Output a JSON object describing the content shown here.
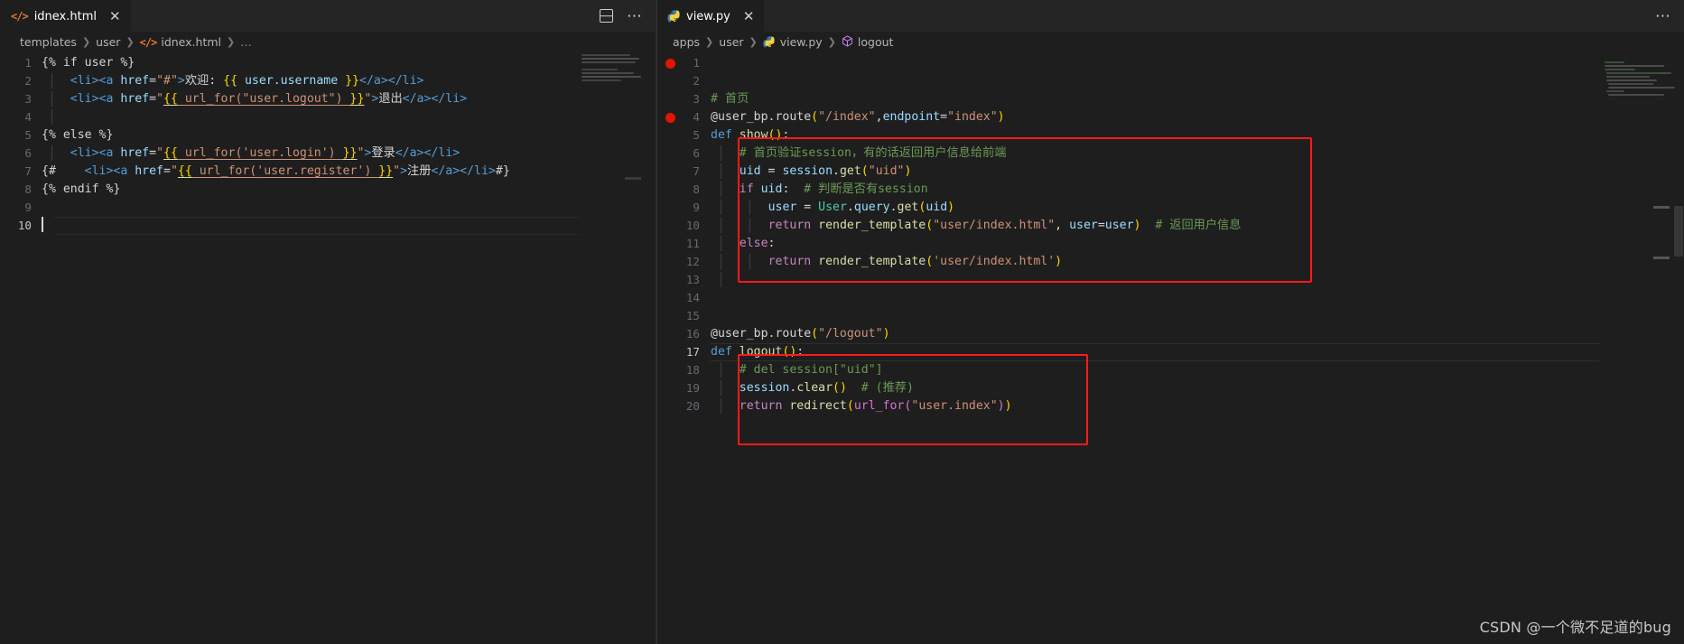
{
  "window": {
    "background": "#1e1e1e",
    "accent_red": "#ff1a1a"
  },
  "left_pane": {
    "tab": {
      "label": "idnex.html",
      "icon": "html-tag-icon",
      "close_label": "✕"
    },
    "actions": {
      "split_editor": "split-editor-icon",
      "more": "⋯"
    },
    "breadcrumb": [
      {
        "label": "templates",
        "icon": null
      },
      {
        "label": "user",
        "icon": null
      },
      {
        "label": "idnex.html",
        "icon": "html-tag-icon"
      },
      {
        "label": "…",
        "icon": null
      }
    ],
    "lines": [
      {
        "n": "1",
        "text": "{% if user %}"
      },
      {
        "n": "2",
        "text": "    <li><a href=\"#\">欢迎: {{ user.username }}</a></li>"
      },
      {
        "n": "3",
        "text": "    <li><a href=\"{{ url_for(\"user.logout\") }}\">退出</a></li>"
      },
      {
        "n": "4",
        "text": ""
      },
      {
        "n": "5",
        "text": "{% else %}"
      },
      {
        "n": "6",
        "text": "    <li><a href=\"{{ url_for('user.login') }}\">登录</a></li>"
      },
      {
        "n": "7",
        "text": "{#    <li><a href=\"{{ url_for('user.register') }}\">注册</a></li>#}"
      },
      {
        "n": "8",
        "text": "{% endif %}"
      },
      {
        "n": "9",
        "text": ""
      },
      {
        "n": "10",
        "text": ""
      }
    ]
  },
  "right_pane": {
    "tab": {
      "label": "view.py",
      "icon": "python-icon",
      "close_label": "✕"
    },
    "actions": {
      "more": "⋯"
    },
    "breadcrumb": [
      {
        "label": "apps",
        "icon": null
      },
      {
        "label": "user",
        "icon": null
      },
      {
        "label": "view.py",
        "icon": "python-icon"
      },
      {
        "label": "logout",
        "icon": "symbol-cube-icon"
      }
    ],
    "lines": [
      {
        "n": "1",
        "text": "",
        "breakpoint": true
      },
      {
        "n": "2",
        "text": ""
      },
      {
        "n": "3",
        "text": "# 首页"
      },
      {
        "n": "4",
        "text": "@user_bp.route(\"/index\",endpoint=\"index\")",
        "breakpoint": true
      },
      {
        "n": "5",
        "text": "def show():"
      },
      {
        "n": "6",
        "text": "    # 首页验证session，有的话返回用户信息给前端"
      },
      {
        "n": "7",
        "text": "    uid = session.get(\"uid\")"
      },
      {
        "n": "8",
        "text": "    if uid:  # 判断是否有session"
      },
      {
        "n": "9",
        "text": "        user = User.query.get(uid)"
      },
      {
        "n": "10",
        "text": "        return render_template(\"user/index.html\", user=user)  # 返回用户信息"
      },
      {
        "n": "11",
        "text": "    else:"
      },
      {
        "n": "12",
        "text": "        return render_template('user/index.html')"
      },
      {
        "n": "13",
        "text": ""
      },
      {
        "n": "14",
        "text": ""
      },
      {
        "n": "15",
        "text": ""
      },
      {
        "n": "16",
        "text": "@user_bp.route(\"/logout\")"
      },
      {
        "n": "17",
        "text": "def logout():"
      },
      {
        "n": "18",
        "text": "    # del session[\"uid\"]"
      },
      {
        "n": "19",
        "text": "    session.clear()  # (推荐)"
      },
      {
        "n": "20",
        "text": "    return redirect(url_for(\"user.index\"))"
      }
    ],
    "annotations": [
      {
        "name": "highlight-box-show",
        "color": "#ff1a1a"
      },
      {
        "name": "highlight-box-logout",
        "color": "#ff1a1a"
      }
    ]
  },
  "watermark": {
    "text": "CSDN @一个微不足道的bug"
  }
}
